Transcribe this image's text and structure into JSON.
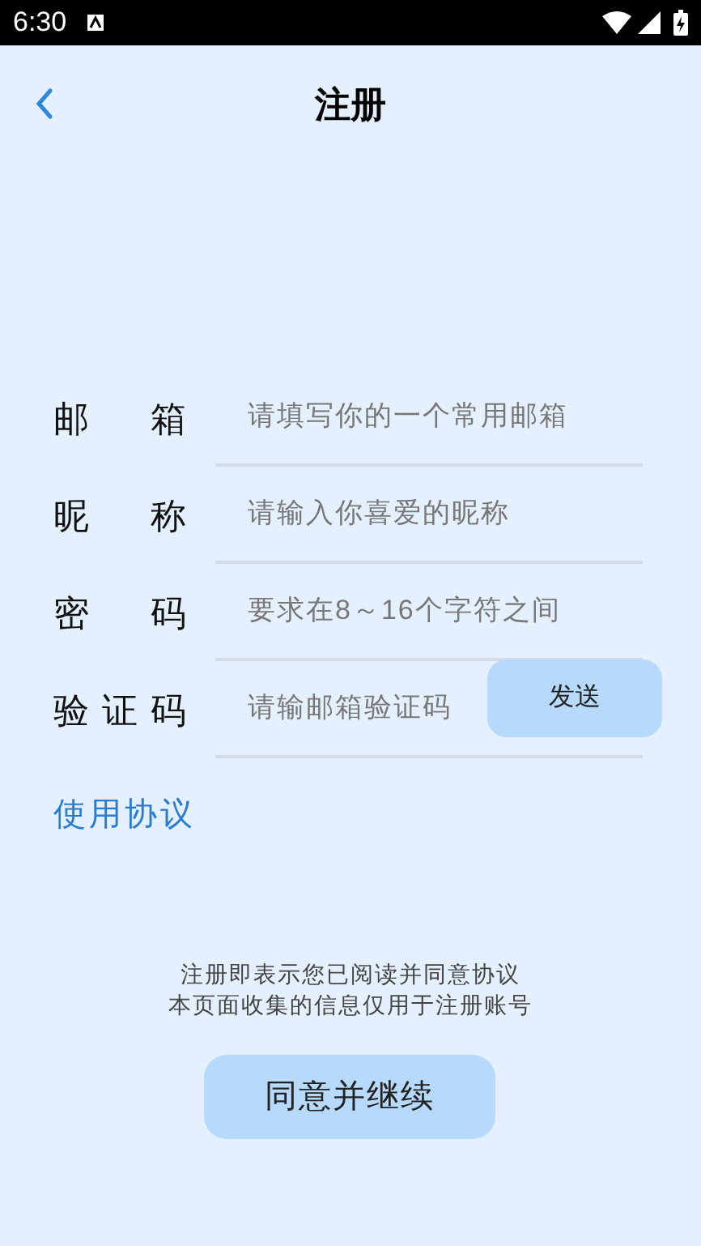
{
  "status_bar": {
    "time": "6:30"
  },
  "header": {
    "title": "注册"
  },
  "fields": [
    {
      "label": "邮箱",
      "placeholder": "请填写你的一个常用邮箱"
    },
    {
      "label": "昵称",
      "placeholder": "请输入你喜爱的昵称"
    },
    {
      "label": "密码",
      "placeholder": "要求在8～16个字符之间"
    },
    {
      "label": "验证码",
      "placeholder": "请输邮箱验证码",
      "button": "发送"
    }
  ],
  "agreement_link": "使用协议",
  "notice": [
    "注册即表示您已阅读并同意协议",
    "本页面收集的信息仅用于注册账号"
  ],
  "submit": "同意并继续"
}
